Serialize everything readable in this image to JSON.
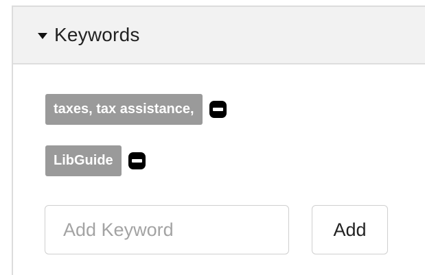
{
  "panel": {
    "title": "Keywords",
    "collapse_icon": "caret-down-icon"
  },
  "keywords": [
    {
      "label": "taxes, tax assistance,",
      "remove_icon": "minus-icon"
    },
    {
      "label": "LibGuide",
      "remove_icon": "minus-icon"
    }
  ],
  "add_form": {
    "input_placeholder": "Add Keyword",
    "input_value": "",
    "add_label": "Add"
  },
  "colors": {
    "tag_background": "#9a9a9a",
    "header_background": "#f2f2f2",
    "remove_button": "#000000"
  }
}
